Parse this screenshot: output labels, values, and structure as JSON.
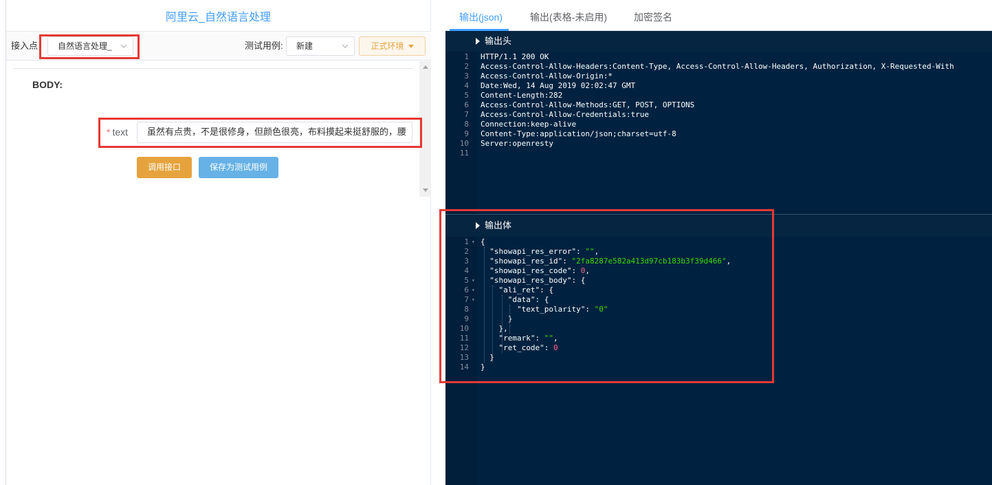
{
  "left": {
    "title": "阿里云_自然语言处理",
    "access_point_label": "接入点",
    "access_point_value": "自然语言处理_",
    "test_case_label": "测试用例:",
    "test_case_value": "新建",
    "env_button": "正式环境",
    "body_label": "BODY:",
    "field": {
      "required_mark": "*",
      "name": "text",
      "value": "虽然有点贵，不是很修身，但颜色很亮，布料摸起来挺舒服的，腰"
    },
    "call_button": "调用接口",
    "save_button": "保存为测试用例"
  },
  "right": {
    "tabs": [
      "输出(json)",
      "输出(表格-未启用)",
      "加密签名"
    ],
    "active_tab": 0,
    "header_section": {
      "title": "输出头",
      "lines": [
        "HTTP/1.1 200 OK",
        "Access-Control-Allow-Headers:Content-Type, Access-Control-Allow-Headers, Authorization, X-Requested-With",
        "Access-Control-Allow-Origin:*",
        "Date:Wed, 14 Aug 2019 02:02:47 GMT",
        "Content-Length:282",
        "Access-Control-Allow-Methods:GET, POST, OPTIONS",
        "Access-Control-Allow-Credentials:true",
        "Connection:keep-alive",
        "Content-Type:application/json;charset=utf-8",
        "Server:openresty",
        ""
      ]
    },
    "body_section": {
      "title": "输出体",
      "lines": [
        {
          "n": "1",
          "fold": true,
          "parts": [
            [
              "p",
              "{"
            ]
          ]
        },
        {
          "n": "2",
          "parts": [
            [
              "p",
              "  "
            ],
            [
              "k",
              "\"showapi_res_error\""
            ],
            [
              "p",
              ": "
            ],
            [
              "s",
              "\"\""
            ],
            [
              "p",
              ","
            ]
          ]
        },
        {
          "n": "3",
          "parts": [
            [
              "p",
              "  "
            ],
            [
              "k",
              "\"showapi_res_id\""
            ],
            [
              "p",
              ": "
            ],
            [
              "s",
              "\"2fa8287e582a413d97cb183b3f39d466\""
            ],
            [
              "p",
              ","
            ]
          ]
        },
        {
          "n": "4",
          "parts": [
            [
              "p",
              "  "
            ],
            [
              "k",
              "\"showapi_res_code\""
            ],
            [
              "p",
              ": "
            ],
            [
              "n",
              "0"
            ],
            [
              "p",
              ","
            ]
          ]
        },
        {
          "n": "5",
          "fold": true,
          "parts": [
            [
              "p",
              "  "
            ],
            [
              "k",
              "\"showapi_res_body\""
            ],
            [
              "p",
              ": {"
            ]
          ]
        },
        {
          "n": "6",
          "fold": true,
          "parts": [
            [
              "p",
              "    "
            ],
            [
              "k",
              "\"ali_ret\""
            ],
            [
              "p",
              ": {"
            ]
          ]
        },
        {
          "n": "7",
          "fold": true,
          "parts": [
            [
              "p",
              "      "
            ],
            [
              "k",
              "\"data\""
            ],
            [
              "p",
              ": {"
            ]
          ]
        },
        {
          "n": "8",
          "parts": [
            [
              "p",
              "        "
            ],
            [
              "k",
              "\"text_polarity\""
            ],
            [
              "p",
              ": "
            ],
            [
              "s",
              "\"0\""
            ]
          ]
        },
        {
          "n": "9",
          "parts": [
            [
              "p",
              "      }"
            ]
          ]
        },
        {
          "n": "10",
          "parts": [
            [
              "p",
              "    },"
            ]
          ]
        },
        {
          "n": "11",
          "parts": [
            [
              "p",
              "    "
            ],
            [
              "k",
              "\"remark\""
            ],
            [
              "p",
              ": "
            ],
            [
              "s",
              "\"\""
            ],
            [
              "p",
              ","
            ]
          ]
        },
        {
          "n": "12",
          "parts": [
            [
              "p",
              "    "
            ],
            [
              "k",
              "\"ret_code\""
            ],
            [
              "p",
              ": "
            ],
            [
              "n",
              "0"
            ]
          ]
        },
        {
          "n": "13",
          "parts": [
            [
              "p",
              "  }"
            ]
          ]
        },
        {
          "n": "14",
          "parts": [
            [
              "p",
              "}"
            ]
          ]
        }
      ]
    }
  },
  "colors": {
    "accent": "#409eff",
    "code_bg": "#002240",
    "string": "#3ad900",
    "number": "#ff628c",
    "highlight_box": "#e53935",
    "warning": "#e6a23c"
  },
  "icons": [
    "chevron-down-icon",
    "caret-down-icon",
    "triangle-right-icon",
    "fold-arrow-icon",
    "scroll-up-icon",
    "scroll-down-icon"
  ]
}
